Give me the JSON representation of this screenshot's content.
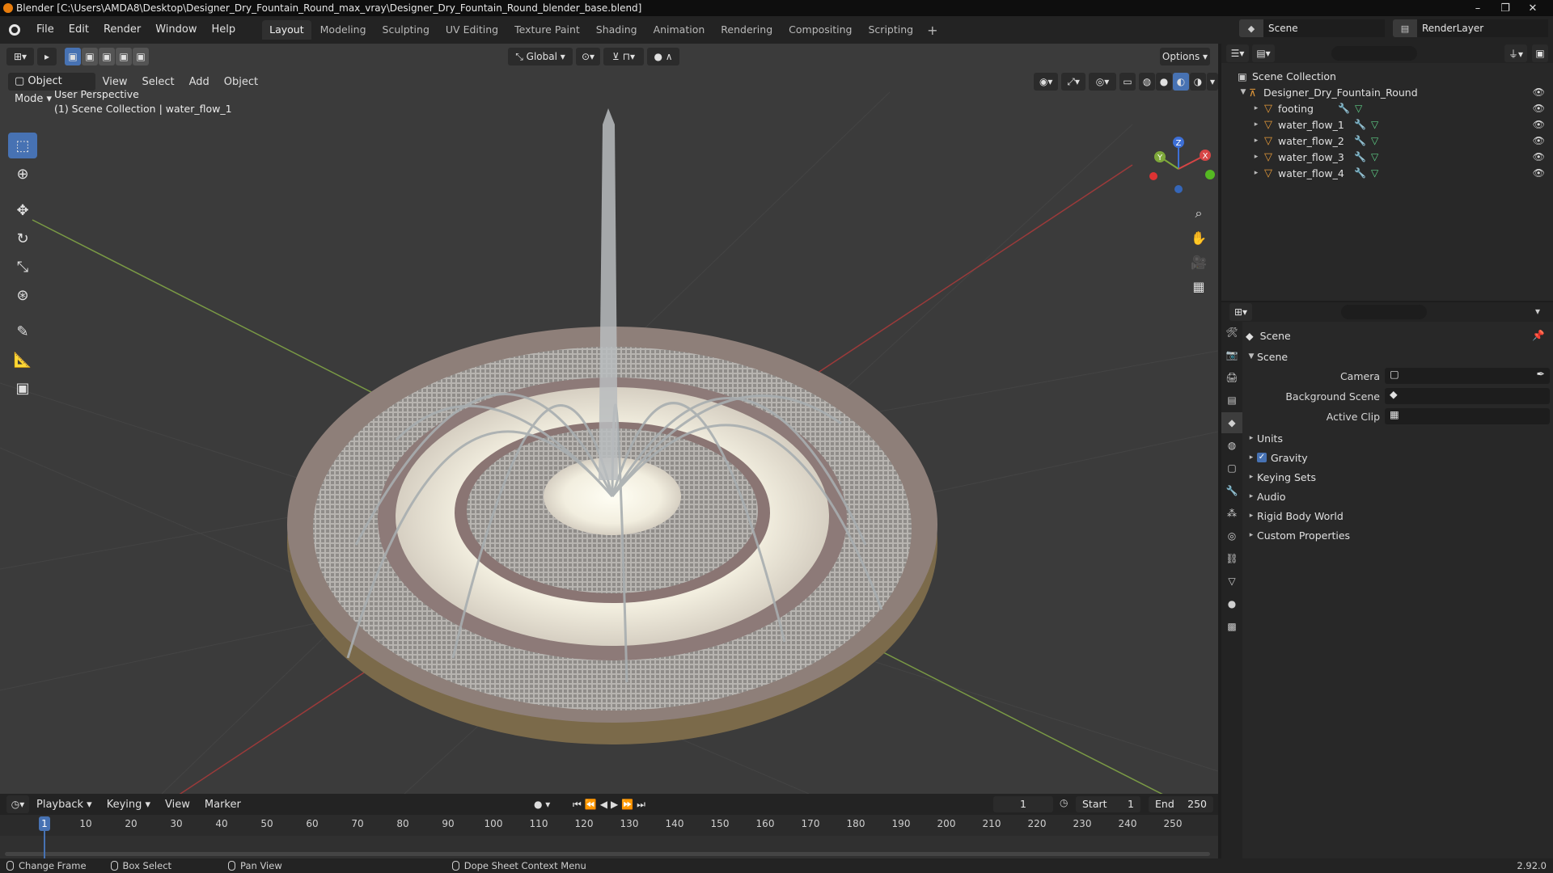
{
  "window": {
    "title": "Blender [C:\\Users\\AMDA8\\Desktop\\Designer_Dry_Fountain_Round_max_vray\\Designer_Dry_Fountain_Round_blender_base.blend]",
    "controls": [
      "–",
      "❐",
      "✕"
    ]
  },
  "menu": [
    "File",
    "Edit",
    "Render",
    "Window",
    "Help"
  ],
  "workspaces": {
    "tabs": [
      "Layout",
      "Modeling",
      "Sculpting",
      "UV Editing",
      "Texture Paint",
      "Shading",
      "Animation",
      "Rendering",
      "Compositing",
      "Scripting"
    ],
    "active": "Layout",
    "add": "+"
  },
  "scene_selector": {
    "value": "Scene"
  },
  "renderlayer_selector": {
    "value": "RenderLayer"
  },
  "viewport": {
    "transform_orientation": "Global",
    "options_label": "Options",
    "mode": "Object Mode",
    "menus": [
      "View",
      "Select",
      "Add",
      "Object"
    ],
    "overlay_line1": "User Perspective",
    "overlay_line2": "(1) Scene Collection | water_flow_1",
    "gizmo": {
      "x": "X",
      "y": "Y",
      "z": "Z"
    }
  },
  "outliner": {
    "root": "Scene Collection",
    "collection": "Designer_Dry_Fountain_Round",
    "objects": [
      "footing",
      "water_flow_1",
      "water_flow_2",
      "water_flow_3",
      "water_flow_4"
    ]
  },
  "properties": {
    "context": "Scene",
    "panel_scene": "Scene",
    "camera_label": "Camera",
    "background_label": "Background Scene",
    "clip_label": "Active Clip",
    "panels": [
      "Units",
      "Gravity",
      "Keying Sets",
      "Audio",
      "Rigid Body World",
      "Custom Properties"
    ],
    "gravity_checked": true
  },
  "timeline": {
    "menus": [
      "Playback",
      "Keying",
      "View",
      "Marker"
    ],
    "current_frame": "1",
    "start_label": "Start",
    "start": "1",
    "end_label": "End",
    "end": "250",
    "ticks": [
      "1",
      "10",
      "20",
      "30",
      "40",
      "50",
      "60",
      "70",
      "80",
      "90",
      "100",
      "110",
      "120",
      "130",
      "140",
      "150",
      "160",
      "170",
      "180",
      "190",
      "200",
      "210",
      "220",
      "230",
      "240",
      "250"
    ]
  },
  "statusbar": {
    "change_frame": "Change Frame",
    "box_select": "Box Select",
    "pan_view": "Pan View",
    "context_menu": "Dope Sheet Context Menu",
    "version": "2.92.0"
  }
}
